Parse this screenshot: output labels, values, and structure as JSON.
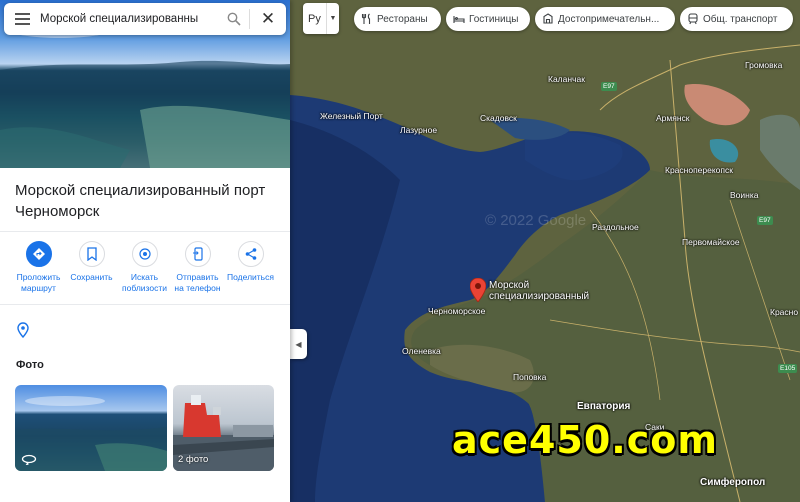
{
  "search": {
    "query": "Морской специализированны"
  },
  "place": {
    "title": "Морской специализированный порт Черноморск"
  },
  "actions": [
    {
      "label": "Проложить маршрут",
      "icon": "directions-icon"
    },
    {
      "label": "Сохранить",
      "icon": "bookmark-icon"
    },
    {
      "label": "Искать поблизости",
      "icon": "nearby-icon"
    },
    {
      "label": "Отправить на телефон",
      "icon": "phone-icon"
    },
    {
      "label": "Поделиться",
      "icon": "share-icon"
    }
  ],
  "photos": {
    "heading": "Фото",
    "second_caption": "2 фото"
  },
  "map": {
    "layer_value": "Ру",
    "chips": [
      "Рестораны",
      "Гостиницы",
      "Достопримечательн...",
      "Общ. транспорт"
    ],
    "copyright": "© 2022 Google",
    "pin_label": "Морской специализированный",
    "labels": {
      "zheleznyi_port": "Железный Порт",
      "lazurnoe": "Лазурное",
      "skadovsk": "Скадовск",
      "kalanchak": "Каланчак",
      "armyansk": "Армянск",
      "gromovka": "Громовка",
      "krasnoperekopsk": "Красноперекопск",
      "voinka": "Воинка",
      "razdolnoe": "Раздольное",
      "pervomaiskoe": "Первомайское",
      "chernomorskoe": "Черноморское",
      "olenevka": "Оленевка",
      "krasno": "Красно",
      "popovka": "Поповка",
      "evpatoria": "Евпатория",
      "saki": "Саки",
      "simferopol": "Симферопол"
    },
    "road_badges": {
      "e97a": "E97",
      "e97b": "E97",
      "e105": "E105"
    }
  },
  "watermark": "ace450.com"
}
